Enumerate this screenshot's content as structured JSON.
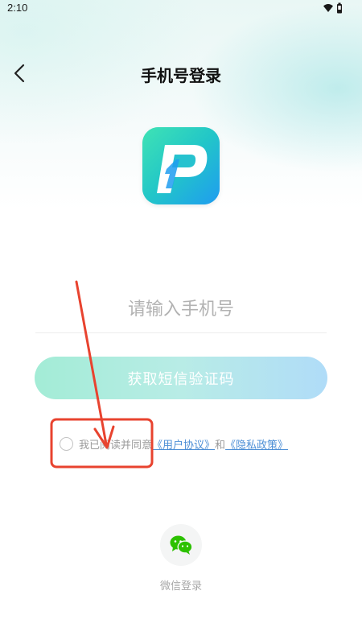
{
  "status_bar": {
    "time": "2:10",
    "icons": [
      "wifi-icon",
      "battery-icon"
    ]
  },
  "header": {
    "back_icon": "chevron-left-icon",
    "title": "手机号登录"
  },
  "logo": {
    "icon": "app-logo-p-icon",
    "colors": [
      "#3fe3b4",
      "#22c6c8",
      "#1f9cf0"
    ]
  },
  "login_form": {
    "phone_placeholder": "请输入手机号",
    "phone_value": "",
    "get_code_label": "获取短信验证码"
  },
  "agreement": {
    "checked": false,
    "prefix": "我已阅读并同意",
    "user_agreement": "《用户协议》",
    "and": "和",
    "privacy_policy": "《隐私政策》"
  },
  "wechat_login": {
    "icon": "wechat-icon",
    "label": "微信登录",
    "color": "#2dc100"
  },
  "annotation": {
    "color": "#e8432f",
    "shapes": [
      "arrow",
      "highlight-box"
    ]
  }
}
